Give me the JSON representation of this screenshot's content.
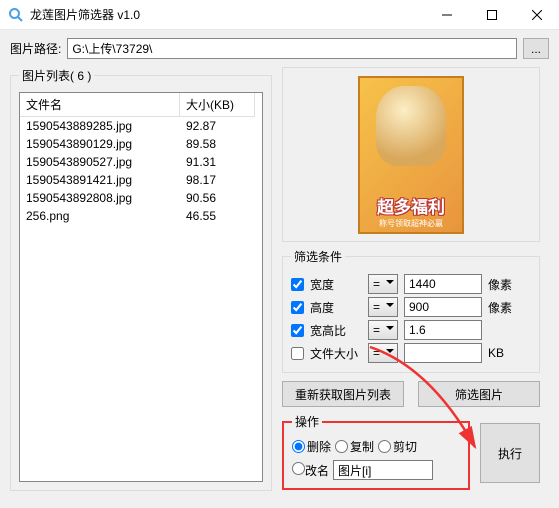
{
  "window": {
    "title": "龙莲图片筛选器 v1.0"
  },
  "path": {
    "label": "图片路径:",
    "value": "G:\\上传\\73729\\"
  },
  "list": {
    "legend": "图片列表( 6 )",
    "col_name": "文件名",
    "col_size": "大小(KB)",
    "rows": [
      {
        "name": "1590543889285.jpg",
        "size": "92.87"
      },
      {
        "name": "1590543890129.jpg",
        "size": "89.58"
      },
      {
        "name": "1590543890527.jpg",
        "size": "91.31"
      },
      {
        "name": "1590543891421.jpg",
        "size": "98.17"
      },
      {
        "name": "1590543892808.jpg",
        "size": "90.56"
      },
      {
        "name": "256.png",
        "size": "46.55"
      }
    ]
  },
  "preview": {
    "banner": "超多福利",
    "sub": "称号领取超神必赢"
  },
  "filter": {
    "legend": "筛选条件",
    "width": {
      "label": "宽度",
      "op": "=",
      "val": "1440",
      "unit": "像素",
      "checked": true
    },
    "height": {
      "label": "高度",
      "op": "=",
      "val": "900",
      "unit": "像素",
      "checked": true
    },
    "ratio": {
      "label": "宽高比",
      "op": "=",
      "val": "1.6",
      "unit": "",
      "checked": true
    },
    "fsize": {
      "label": "文件大小",
      "op": "=",
      "val": "",
      "unit": "KB",
      "checked": false
    }
  },
  "buttons": {
    "reload": "重新获取图片列表",
    "do_filter": "筛选图片",
    "execute": "执行"
  },
  "ops": {
    "legend": "操作",
    "delete": "删除",
    "copy": "复制",
    "cut": "剪切",
    "rename": "改名",
    "rename_val": "图片[i]"
  }
}
